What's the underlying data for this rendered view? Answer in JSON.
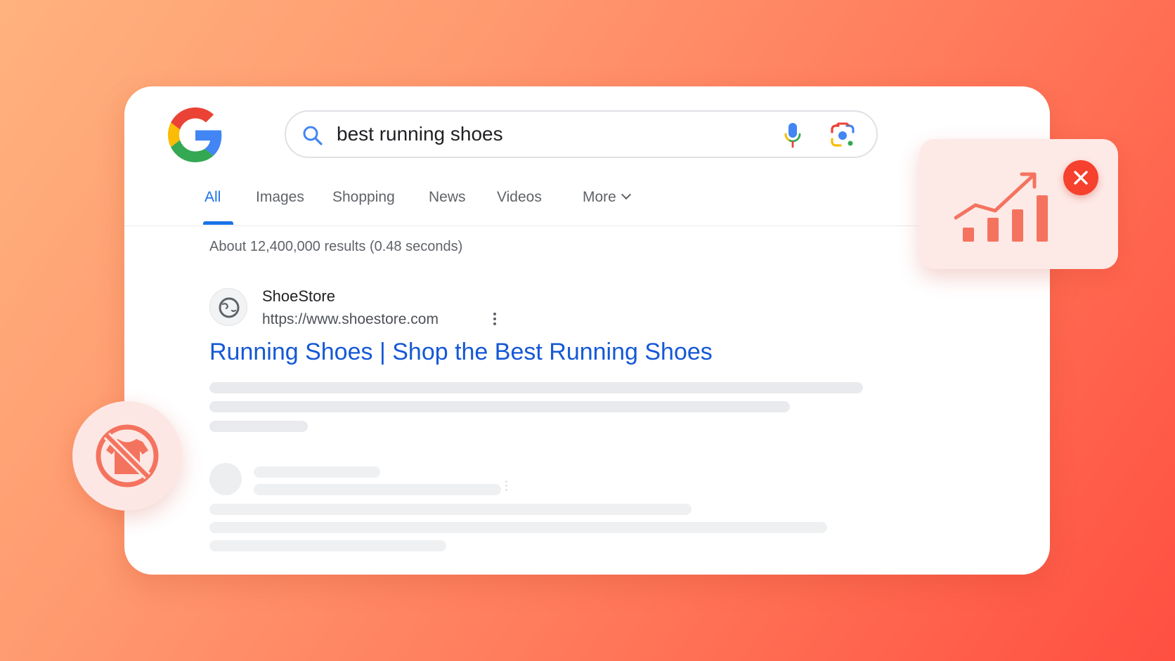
{
  "search": {
    "query": "best running shoes"
  },
  "tabs": [
    {
      "label": "All",
      "active": true
    },
    {
      "label": "Images",
      "active": false
    },
    {
      "label": "Shopping",
      "active": false
    },
    {
      "label": "News",
      "active": false
    },
    {
      "label": "Videos",
      "active": false
    },
    {
      "label": "More",
      "active": false
    }
  ],
  "results": {
    "stats": "About 12,400,000 results (0.48 seconds)",
    "first": {
      "site_name": "ShoeStore",
      "url": "https://www.shoestore.com",
      "title": "Running Shoes | Shop the Best Running Shoes"
    }
  },
  "icons": {
    "logo": "google-g-logo",
    "search": "search-icon",
    "mic": "microphone-icon",
    "lens": "camera-lens-icon",
    "favicon": "globe-icon",
    "more_options": "kebab-menu-icon",
    "no_apparel": "no-shirt-icon",
    "growth_chart": "growth-chart-icon",
    "close": "close-icon"
  },
  "colors": {
    "google_blue": "#4285F4",
    "google_red": "#EA4335",
    "google_yellow": "#FBBC05",
    "google_green": "#34A853",
    "link_blue": "#1558d6",
    "accent_red": "#f5412d",
    "coral": "#f4735f"
  }
}
